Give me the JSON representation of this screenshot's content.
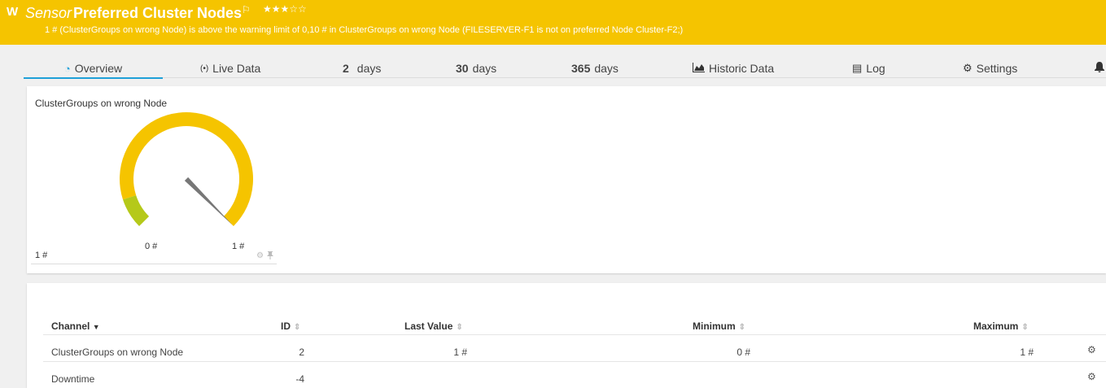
{
  "header": {
    "status_letter": "W",
    "sensor_word": "Sensor",
    "sensor_name": "Preferred Cluster Nodes",
    "flag_icon": "flag-icon",
    "stars": "★★★☆☆",
    "message": "1 # (ClusterGroups on wrong Node) is above the warning limit of 0,10 # in ClusterGroups on wrong Node (FILESERVER-F1 is not on preferred Node Cluster-F2;)",
    "accent_color": "#f5c400"
  },
  "tabs": [
    {
      "icon": "gauge-icon",
      "glyph": "◔",
      "label": "Overview"
    },
    {
      "icon": "live-data-icon",
      "glyph": "(•)",
      "label": "Live Data"
    },
    {
      "num": "2",
      "label": "days"
    },
    {
      "num": "30",
      "label": "days"
    },
    {
      "num": "365",
      "label": "days"
    },
    {
      "icon": "chart-icon",
      "glyph": "▟",
      "label": "Historic Data"
    },
    {
      "icon": "log-icon",
      "glyph": "▤",
      "label": "Log"
    },
    {
      "icon": "gear-icon",
      "glyph": "⚙",
      "label": "Settings"
    },
    {
      "icon": "bell-icon",
      "glyph": "🔔",
      "label": ""
    }
  ],
  "gauge": {
    "title": "ClusterGroups on wrong Node",
    "min_label": "0 #",
    "max_label": "1 #",
    "value_label": "1 #",
    "value_fraction": 1.0,
    "warning_fraction": 0.1,
    "colors": {
      "ok": "#b5c91a",
      "warning": "#f5c400",
      "needle": "#777777"
    }
  },
  "table": {
    "headers": {
      "channel": "Channel",
      "id": "ID",
      "last_value": "Last Value",
      "minimum": "Minimum",
      "maximum": "Maximum"
    },
    "rows": [
      {
        "channel": "ClusterGroups on wrong Node",
        "id": "2",
        "last_value": "1 #",
        "minimum": "0 #",
        "maximum": "1 #"
      },
      {
        "channel": "Downtime",
        "id": "-4",
        "last_value": "",
        "minimum": "",
        "maximum": ""
      }
    ]
  }
}
